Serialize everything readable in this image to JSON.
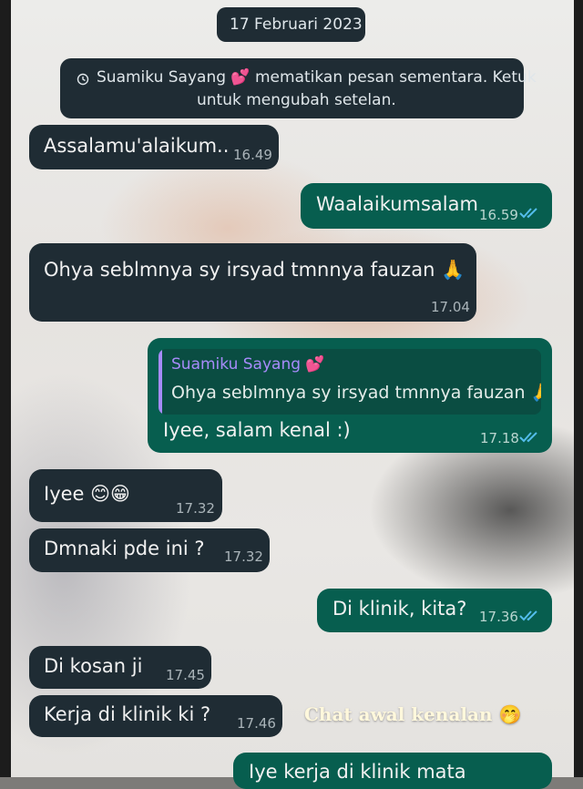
{
  "date_header": "17 Februari 2023",
  "system_notice": {
    "line1": "Suamiku Sayang 💕 mematikan pesan sementara. Ketuk",
    "line2": "untuk mengubah setelan."
  },
  "messages": [
    {
      "dir": "in",
      "text": "Assalamu'alaikum..",
      "time": "16.49"
    },
    {
      "dir": "out",
      "text": "Waalaikumsalam",
      "time": "16.59"
    },
    {
      "dir": "in",
      "text": "Ohya seblmnya sy irsyad tmnnya fauzan 🙏",
      "time": "17.04"
    },
    {
      "dir": "out",
      "quote_author": "Suamiku Sayang 💕",
      "quote_text": "Ohya seblmnya sy irsyad tmnnya fauzan 🙏",
      "text": "Iyee, salam kenal :)",
      "time": "17.18"
    },
    {
      "dir": "in",
      "text": "Iyee 😊😁",
      "time": "17.32"
    },
    {
      "dir": "in",
      "text": "Dmnaki pde ini ?",
      "time": "17.32"
    },
    {
      "dir": "out",
      "text": "Di klinik, kita?",
      "time": "17.36"
    },
    {
      "dir": "in",
      "text": "Di kosan ji",
      "time": "17.45"
    },
    {
      "dir": "in",
      "text": "Kerja di klinik ki ?",
      "time": "17.46"
    },
    {
      "dir": "out",
      "text": "Iye kerja di klinik mata",
      "time": ""
    }
  ],
  "caption": "Chat awal kenalan 🤭",
  "colors": {
    "incoming_bubble": "#1f2c34",
    "outgoing_bubble": "#075e4f",
    "read_ticks": "#53bdeb",
    "quote_author": "#a78bfa"
  }
}
